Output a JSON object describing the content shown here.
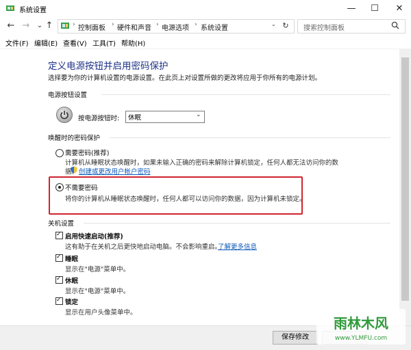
{
  "window": {
    "title": "系统设置",
    "minimize_glyph": "—",
    "maximize_glyph": "☐",
    "close_glyph": "✕"
  },
  "nav": {
    "back_glyph": "←",
    "forward_glyph": "→",
    "dropdown_glyph": "⌄",
    "up_glyph": "↑",
    "breadcrumb": [
      "控制面板",
      "硬件和声音",
      "电源选项",
      "系统设置"
    ],
    "breadcrumb_sep": "›",
    "address_dropdown_glyph": "⌄",
    "refresh_glyph": "↻",
    "search_placeholder": "搜索控制面板"
  },
  "menu": [
    "文件(F)",
    "编辑(E)",
    "查看(V)",
    "工具(T)",
    "帮助(H)"
  ],
  "page": {
    "title": "定义电源按钮并启用密码保护",
    "description": "选择要为你的计算机设置的电源设置。在此页上对设置所做的更改将应用于你所有的电源计划。"
  },
  "power_button": {
    "section_title": "电源按钮设置",
    "label": "按电源按钮时:",
    "selected": "休眠"
  },
  "wake_password": {
    "section_title": "唤醒时的密码保护",
    "options": [
      {
        "title": "需要密码(推荐)",
        "desc_line1": "计算机从睡眠状态唤醒时，如果未输入正确的密码来解除计算机锁定，任何人都无法访问你的数",
        "desc_line2": "据。",
        "link": "创建或更改用户帐户密码",
        "selected": false
      },
      {
        "title": "不需要密码",
        "desc": "将你的计算机从睡眠状态唤醒时，任何人都可以访问你的数据，因为计算机未锁定。",
        "selected": true
      }
    ]
  },
  "shutdown": {
    "section_title": "关机设置",
    "items": [
      {
        "title": "启用快速启动(推荐)",
        "desc": "这有助于在关机之后更快地启动电脑。不会影响重启。",
        "link": "了解更多信息",
        "checked": true
      },
      {
        "title": "睡眠",
        "desc": "显示在\"电源\"菜单中。",
        "checked": true
      },
      {
        "title": "休眠",
        "desc": "显示在\"电源\"菜单中。",
        "checked": true
      },
      {
        "title": "锁定",
        "desc": "显示在用户头像菜单中。",
        "checked": true
      }
    ]
  },
  "footer": {
    "save_label": "保存修改"
  },
  "watermark": {
    "text": "雨林木风",
    "url": "www.YLMFU.com"
  },
  "colors": {
    "title_blue": "#1e3287",
    "link_blue": "#0b58b8",
    "highlight_red": "#d0232d",
    "watermark_green": "#2f9a3a"
  },
  "icons": {
    "title": "control-panel-icon",
    "power": "power-icon",
    "uac": "uac-shield-icon",
    "search": "search-icon",
    "check": "✓"
  }
}
